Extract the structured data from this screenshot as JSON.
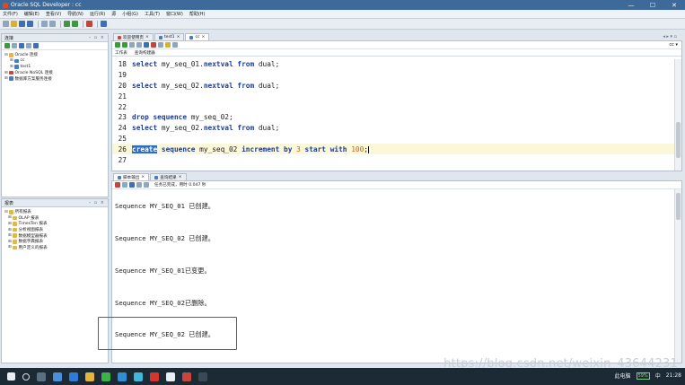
{
  "window": {
    "title": "Oracle SQL Developer : cc",
    "controls": [
      "—",
      "☐",
      "✕"
    ]
  },
  "menu": [
    "文件(F)",
    "编辑(E)",
    "查看(V)",
    "导航(N)",
    "运行(R)",
    "源",
    "小组(G)",
    "工具(T)",
    "窗口(W)",
    "帮助(H)"
  ],
  "connections_panel": {
    "title": "连接",
    "items": [
      {
        "label": "Oracle 连接",
        "level": 0,
        "expander": "⊟"
      },
      {
        "label": "cc",
        "level": 1,
        "expander": "⊞"
      },
      {
        "label": "test1",
        "level": 1,
        "expander": "⊞"
      },
      {
        "label": "Oracle NoSQL 连接",
        "level": 0,
        "expander": "⊞"
      },
      {
        "label": "数据库方案服务连接",
        "level": 0,
        "expander": "⊞"
      }
    ]
  },
  "reports_panel": {
    "title": "报表",
    "items": [
      {
        "label": "所有报表",
        "expander": "⊟"
      },
      {
        "label": "OLAP 报表",
        "expander": "⊞"
      },
      {
        "label": "TimesTen 报表",
        "expander": "⊞"
      },
      {
        "label": "分析视图报表",
        "expander": "⊞"
      },
      {
        "label": "数据模型器报表",
        "expander": "⊞"
      },
      {
        "label": "数据字典报表",
        "expander": "⊞"
      },
      {
        "label": "用户定义的报表",
        "expander": "⊞"
      }
    ]
  },
  "editor_tabs": [
    {
      "label": "欢迎使用页",
      "active": false
    },
    {
      "label": "test1",
      "active": false
    },
    {
      "label": "cc",
      "active": true
    }
  ],
  "editor_subtabs": [
    "工作表",
    "查询构建器"
  ],
  "editor_lines": [
    {
      "no": "18",
      "text": "select my_seq_01.nextval from dual;"
    },
    {
      "no": "19",
      "text": ""
    },
    {
      "no": "20",
      "text": "select my_seq_02.nextval from dual;"
    },
    {
      "no": "21",
      "text": ""
    },
    {
      "no": "22",
      "text": ""
    },
    {
      "no": "23",
      "text": "drop sequence my_seq_02;"
    },
    {
      "no": "24",
      "text": "select my_seq_02.nextval from dual;"
    },
    {
      "no": "25",
      "text": ""
    },
    {
      "no": "26",
      "text": "create sequence my_seq_02 increment by 3 start with 100;"
    },
    {
      "no": "27",
      "text": ""
    }
  ],
  "output_tabs": [
    "脚本输出",
    "查询结果"
  ],
  "output_status": "任务已完成，用时 0.047 秒",
  "output_lines": [
    "Sequence MY_SEQ_01 已创建。",
    "Sequence MY_SEQ_02 已创建。",
    "Sequence MY_SEQ_01已变更。",
    "Sequence MY_SEQ_02已删除。",
    "Sequence MY_SEQ_02 已创建。"
  ],
  "taskbar": {
    "tray_text": "此电脑",
    "battery": "59%",
    "lang": "中",
    "time": "21:28"
  },
  "watermark": "https://blog.csdn.net/weixin_43644231",
  "colors": {
    "titlebar": "#3d6a9a",
    "keyword": "#1c3b9c",
    "number": "#c5671a",
    "selection": "#2f6cc6",
    "annotation_box": "#e2261c"
  }
}
